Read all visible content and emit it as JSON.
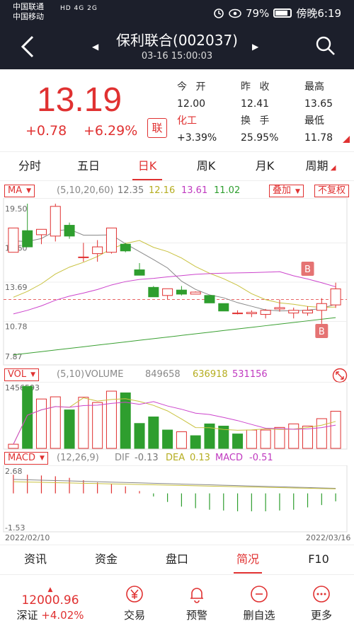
{
  "status_bar": {
    "carrier1": "中国联通",
    "carrier2": "中国移动",
    "net_icons": "HD 4G 2G",
    "battery": "79%",
    "time": "傍晚6:19"
  },
  "header": {
    "title": "保利联合(002037)",
    "datetime": "03-16 15:00:03"
  },
  "quote": {
    "price": "13.19",
    "change": "+0.78",
    "change_pct": "+6.29%",
    "lian": "联",
    "open_label": "今 开",
    "open": "12.00",
    "prev_label": "昨 收",
    "prev": "12.41",
    "high_label": "最高",
    "high": "13.65",
    "sector_label": "化工",
    "sector_pct": "+3.39%",
    "turnover_label": "换 手",
    "turnover": "25.95%",
    "low_label": "最低",
    "low": "11.78"
  },
  "k_tabs": [
    "分时",
    "五日",
    "日K",
    "周K",
    "月K",
    "周期"
  ],
  "ma": {
    "label": "MA",
    "params": "(5,10,20,60)",
    "v1": "12.35",
    "v2": "12.16",
    "v3": "13.61",
    "v4": "11.02",
    "overlay_btn": "叠加",
    "adjust_btn": "不复权",
    "colors": {
      "ma5": "#888888",
      "ma10": "#c9c240",
      "ma20": "#cc44cc",
      "ma60": "#3aa032"
    }
  },
  "price_axis": [
    "19.50",
    "16.60",
    "13.69",
    "10.78",
    "7.87"
  ],
  "vol": {
    "label": "VOL",
    "params": "(5,10)",
    "name": "VOLUME",
    "v1": "849658",
    "v2": "636918",
    "v3": "531156",
    "axis_top": "1456593"
  },
  "macd": {
    "label": "MACD",
    "params": "(12,26,9)",
    "dif_label": "DIF",
    "dif": "-0.13",
    "dea_label": "DEA",
    "dea": "0.13",
    "macd_label": "MACD",
    "macd_val": "-0.51",
    "axis_top": "2.68",
    "axis_bottom": "-1.53",
    "date_start": "2022/02/10",
    "date_end": "2022/03/16"
  },
  "markers": [
    "B",
    "B"
  ],
  "bottom_tabs": [
    "资讯",
    "资金",
    "盘口",
    "简况",
    "F10"
  ],
  "index": {
    "value": "12000.96",
    "name": "深证",
    "pct": "+4.02%"
  },
  "actions": [
    "交易",
    "预警",
    "删自选",
    "更多"
  ],
  "accent": "#e03131",
  "down_color": "#2e9e2e",
  "chart_data": [
    {
      "type": "candlestick",
      "title": "",
      "y_range": [
        7.87,
        19.5
      ],
      "x_range": [
        "2022/02/10",
        "2022/03/16"
      ],
      "candles": [
        {
          "o": 15.9,
          "c": 17.7,
          "h": 17.7,
          "l": 15.9
        },
        {
          "o": 17.5,
          "c": 16.3,
          "h": 19.5,
          "l": 16.3
        },
        {
          "o": 17.2,
          "c": 17.6,
          "h": 17.6,
          "l": 16.5
        },
        {
          "o": 17.1,
          "c": 19.3,
          "h": 19.5,
          "l": 16.7
        },
        {
          "o": 17.9,
          "c": 17.1,
          "h": 18.1,
          "l": 16.9
        },
        {
          "o": 15.5,
          "c": 15.55,
          "h": 16.6,
          "l": 15.2
        },
        {
          "o": 15.8,
          "c": 16.3,
          "h": 16.8,
          "l": 15.2
        },
        {
          "o": 15.9,
          "c": 17.7,
          "h": 17.7,
          "l": 15.8
        },
        {
          "o": 16.5,
          "c": 16.0,
          "h": 16.6,
          "l": 15.9
        },
        {
          "o": 14.6,
          "c": 14.2,
          "h": 15.1,
          "l": 14.2
        },
        {
          "o": 13.3,
          "c": 12.6,
          "h": 13.4,
          "l": 12.6
        },
        {
          "o": 12.7,
          "c": 13.2,
          "h": 13.2,
          "l": 12.4
        },
        {
          "o": 13.1,
          "c": 12.8,
          "h": 13.4,
          "l": 12.7
        },
        {
          "o": 12.8,
          "c": 12.95,
          "h": 13.0,
          "l": 12.8
        },
        {
          "o": 12.7,
          "c": 12.15,
          "h": 12.7,
          "l": 12.15
        },
        {
          "o": 12.1,
          "c": 11.55,
          "h": 12.1,
          "l": 11.55
        },
        {
          "o": 11.4,
          "c": 11.4,
          "h": 11.6,
          "l": 11.3
        },
        {
          "o": 11.35,
          "c": 11.45,
          "h": 11.6,
          "l": 11.1
        },
        {
          "o": 11.3,
          "c": 11.6,
          "h": 11.7,
          "l": 11.0
        },
        {
          "o": 11.7,
          "c": 11.8,
          "h": 12.4,
          "l": 11.5
        },
        {
          "o": 11.4,
          "c": 11.6,
          "h": 11.8,
          "l": 11.0
        },
        {
          "o": 11.4,
          "c": 11.6,
          "h": 11.9,
          "l": 11.2
        },
        {
          "o": 11.6,
          "c": 12.1,
          "h": 12.5,
          "l": 10.6
        },
        {
          "o": 12.0,
          "c": 13.19,
          "h": 13.65,
          "l": 11.78
        }
      ]
    },
    {
      "type": "bar",
      "title": "VOLUME",
      "y_range": [
        0,
        1456593
      ],
      "values": [
        95000,
        1420000,
        1130000,
        1180000,
        880000,
        1170000,
        1050000,
        1310000,
        1270000,
        570000,
        720000,
        420000,
        380000,
        290000,
        560000,
        510000,
        330000,
        420000,
        420000,
        480000,
        560000,
        510000,
        680000,
        850000
      ],
      "up": [
        true,
        false,
        true,
        true,
        false,
        true,
        true,
        true,
        false,
        false,
        false,
        false,
        true,
        false,
        false,
        false,
        false,
        true,
        true,
        true,
        true,
        true,
        true,
        true
      ]
    },
    {
      "type": "bar",
      "title": "MACD",
      "y_range": [
        -1.53,
        2.68
      ],
      "values": [
        1.2,
        1.2,
        1.15,
        1.1,
        1.0,
        0.85,
        0.7,
        0.6,
        0.45,
        0.15,
        -0.2,
        -0.55,
        -0.85,
        -0.95,
        -1.05,
        -1.1,
        -1.15,
        -1.15,
        -1.15,
        -1.1,
        -1.05,
        -0.9,
        -0.75,
        -0.51
      ]
    }
  ]
}
